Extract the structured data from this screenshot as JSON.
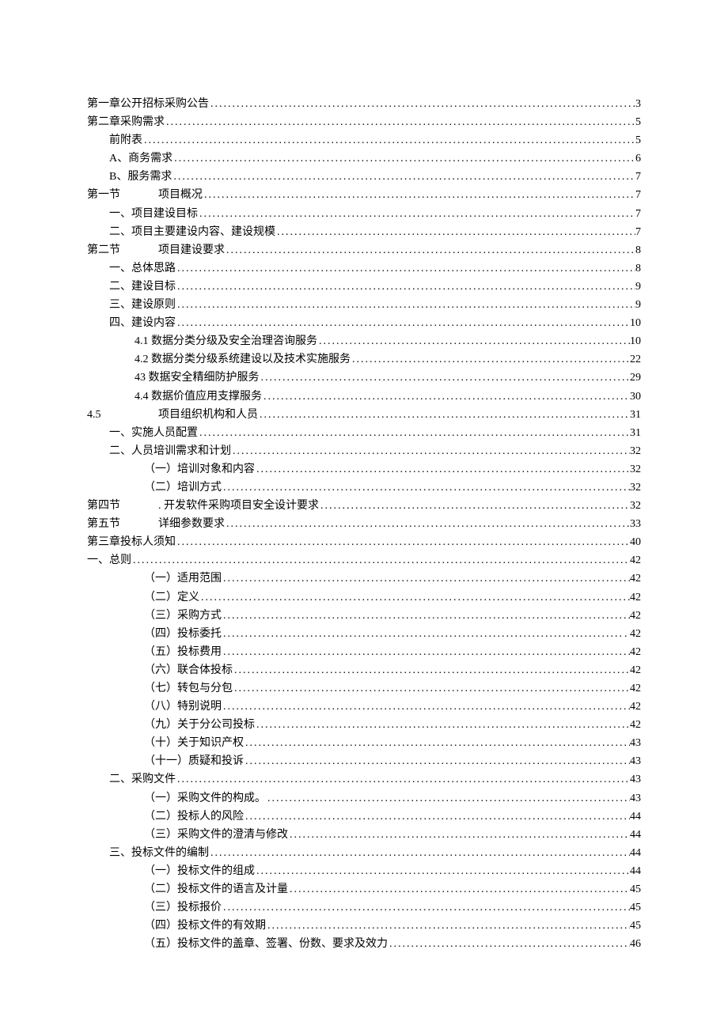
{
  "toc": [
    {
      "label": "第一章公开招标采购公告",
      "page": "3",
      "level": 0
    },
    {
      "label": "第二章采购需求",
      "page": "5",
      "level": 0
    },
    {
      "label": "前附表",
      "page": "5",
      "level": 1
    },
    {
      "label": "A、商务需求",
      "page": "6",
      "level": 1
    },
    {
      "label": "B、服务需求",
      "page": "7",
      "level": 1
    },
    {
      "prefix": "第一节",
      "label": "项目概况",
      "page": "7",
      "level": 0,
      "section": true
    },
    {
      "label": "一、项目建设目标",
      "page": "7",
      "level": 1
    },
    {
      "label": "二、项目主要建设内容、建设规模",
      "page": "7",
      "level": 1
    },
    {
      "prefix": "第二节",
      "label": "项目建设要求",
      "page": "8",
      "level": 0,
      "section": true
    },
    {
      "label": "一、总体思路",
      "page": "8",
      "level": 1
    },
    {
      "label": "二、建设目标",
      "page": "9",
      "level": 1
    },
    {
      "label": "三、建设原则",
      "page": "9",
      "level": 1
    },
    {
      "label": "四、建设内容",
      "page": "10",
      "level": 1
    },
    {
      "label": "4.1  数据分类分级及安全治理咨询服务",
      "page": "10",
      "level": 2
    },
    {
      "label": "4.2  数据分类分级系统建设以及技术实施服务",
      "page": "22",
      "level": 2
    },
    {
      "label": "43 数据安全精细防护服务",
      "page": "29",
      "level": 2
    },
    {
      "label": "4.4  数据价值应用支撑服务",
      "page": "30",
      "level": 2
    },
    {
      "prefix": "4.5",
      "label": "项目组织机构和人员",
      "page": "31",
      "level": 0,
      "section": true
    },
    {
      "label": "一、实施人员配置",
      "page": "31",
      "level": 1
    },
    {
      "label": "二、人员培训需求和计划",
      "page": "32",
      "level": 1
    },
    {
      "label": "（一）培训对象和内容",
      "page": "32",
      "level": 3
    },
    {
      "label": "（二）培训方式",
      "page": "32",
      "level": 3
    },
    {
      "prefix": "第四节",
      "label": ". 开发软件采购项目安全设计要求",
      "page": "32",
      "level": 0,
      "section": true
    },
    {
      "prefix": "第五节",
      "label": "详细参数要求",
      "page": "33",
      "level": 0,
      "section": true
    },
    {
      "label": "第三章投标人须知",
      "page": "40",
      "level": 0
    },
    {
      "label": "一、总则",
      "page": "42",
      "level": 0
    },
    {
      "label": "（一）适用范围",
      "page": "42",
      "level": 3
    },
    {
      "label": "（二）定义",
      "page": "42",
      "level": 3
    },
    {
      "label": "（三）采购方式",
      "page": "42",
      "level": 3
    },
    {
      "label": "（四）投标委托",
      "page": ". 42",
      "level": 3
    },
    {
      "label": "（五）投标费用",
      "page": "42",
      "level": 3
    },
    {
      "label": "（六）联合体投标",
      "page": "42",
      "level": 3
    },
    {
      "label": "（七）转包与分包",
      "page": "42",
      "level": 3
    },
    {
      "label": "（八）特别说明",
      "page": "42",
      "level": 3
    },
    {
      "label": "（九）关于分公司投标",
      "page": "42",
      "level": 3
    },
    {
      "label": "（十）关于知识产权",
      "page": "43",
      "level": 3
    },
    {
      "label": "（十一）质疑和投诉",
      "page": "43",
      "level": 3
    },
    {
      "label": "二、采购文件",
      "page": "43",
      "level": 1
    },
    {
      "label": "（一）采购文件的构成。",
      "page": "43",
      "level": 3
    },
    {
      "label": "（二）投标人的风险",
      "page": "44",
      "level": 3
    },
    {
      "label": "（三）采购文件的澄清与修改",
      "page": "44",
      "level": 3
    },
    {
      "label": "三、投标文件的编制",
      "page": "44",
      "level": 1
    },
    {
      "label": "（一）投标文件的组成",
      "page": "44",
      "level": 3
    },
    {
      "label": "（二）投标文件的语言及计量",
      "page": "45",
      "level": 3
    },
    {
      "label": "（三）投标报价",
      "page": "45",
      "level": 3
    },
    {
      "label": "（四）投标文件的有效期",
      "page": "45",
      "level": 3
    },
    {
      "label": "（五）投标文件的盖章、签署、份数、要求及效力",
      "page": "46",
      "level": 3
    }
  ]
}
